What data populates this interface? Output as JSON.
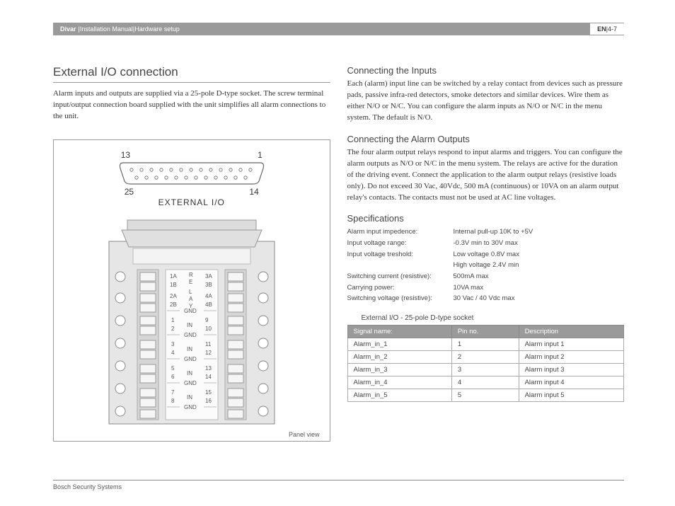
{
  "header": {
    "product": "Divar",
    "sep": " | ",
    "doc": "Installation Manual",
    "section": "Hardware setup",
    "lang": "EN",
    "page": "4-7"
  },
  "left": {
    "title": "External I/O connection",
    "body": "Alarm inputs and outputs are supplied via a 25-pole D-type socket. The screw terminal input/output connection board supplied with the unit simplifies all alarm connections to the unit.",
    "figure_caption": "Panel view",
    "db25": {
      "top_left": "13",
      "top_right": "1",
      "bot_left": "25",
      "bot_right": "14",
      "label": "EXTERNAL I/O"
    },
    "board": {
      "relay_rows": [
        {
          "l1": "1A",
          "l2": "1B",
          "mid1": "R",
          "mid2": "E",
          "r1": "3A",
          "r2": "3B"
        },
        {
          "l1": "2A",
          "l2": "2B",
          "mid1": "L",
          "mid2": "A",
          "mid3": "Y",
          "r1": "4A",
          "r2": "4B"
        }
      ],
      "gnd": "GND",
      "in": "IN",
      "in_rows": [
        {
          "l1": "1",
          "l2": "2",
          "r1": "9",
          "r2": "10"
        },
        {
          "l1": "3",
          "l2": "4",
          "r1": "11",
          "r2": "12"
        },
        {
          "l1": "5",
          "l2": "6",
          "r1": "13",
          "r2": "14"
        },
        {
          "l1": "7",
          "l2": "8",
          "r1": "15",
          "r2": "16"
        }
      ]
    }
  },
  "right": {
    "inputs": {
      "title": "Connecting the Inputs",
      "body": "Each (alarm) input line can be switched by a relay contact from devices such as pressure pads, passive infra-red detectors, smoke detectors and similar devices. Wire them as either N/O or N/C. You can configure the alarm inputs as N/O or N/C in the menu system. The default is N/O."
    },
    "outputs": {
      "title": "Connecting the Alarm Outputs",
      "body": "The four alarm output relays respond to input alarms and triggers. You can configure the alarm outputs as N/O or N/C in the menu system. The relays are active for the duration of the driving event. Connect the application to the alarm output relays (resistive loads only). Do not exceed 30 Vac, 40Vdc, 500 mA (continuous) or 10VA on an alarm output relay's contacts. The contacts must not be used at AC line voltages."
    },
    "specs": {
      "title": "Specifications",
      "rows": [
        {
          "label": "Alarm input impedence:",
          "value": "Internal pull-up 10K to +5V"
        },
        {
          "label": "Input voltage range:",
          "value": "-0.3V min to 30V max"
        },
        {
          "label": "Input voltage treshold:",
          "value": "Low voltage 0.8V max"
        },
        {
          "label": "",
          "value": "High voltage 2.4V min"
        },
        {
          "label": "Switching current (resistive):",
          "value": "500mA max"
        },
        {
          "label": "Carrying power:",
          "value": "10VA max"
        },
        {
          "label": "Switching voltage (resistive):",
          "value": "30 Vac / 40 Vdc max"
        }
      ]
    },
    "pinout": {
      "caption": "External I/O - 25-pole D-type socket",
      "headers": {
        "signal": "Signal name:",
        "pin": "Pin no.",
        "desc": "Description"
      },
      "rows": [
        {
          "signal": "Alarm_in_1",
          "pin": "1",
          "desc": "Alarm input 1"
        },
        {
          "signal": "Alarm_in_2",
          "pin": "2",
          "desc": "Alarm input 2"
        },
        {
          "signal": "Alarm_in_3",
          "pin": "3",
          "desc": "Alarm input 3"
        },
        {
          "signal": "Alarm_in_4",
          "pin": "4",
          "desc": "Alarm input 4"
        },
        {
          "signal": "Alarm_in_5",
          "pin": "5",
          "desc": "Alarm input 5"
        }
      ]
    }
  },
  "footer": "Bosch Security Systems"
}
